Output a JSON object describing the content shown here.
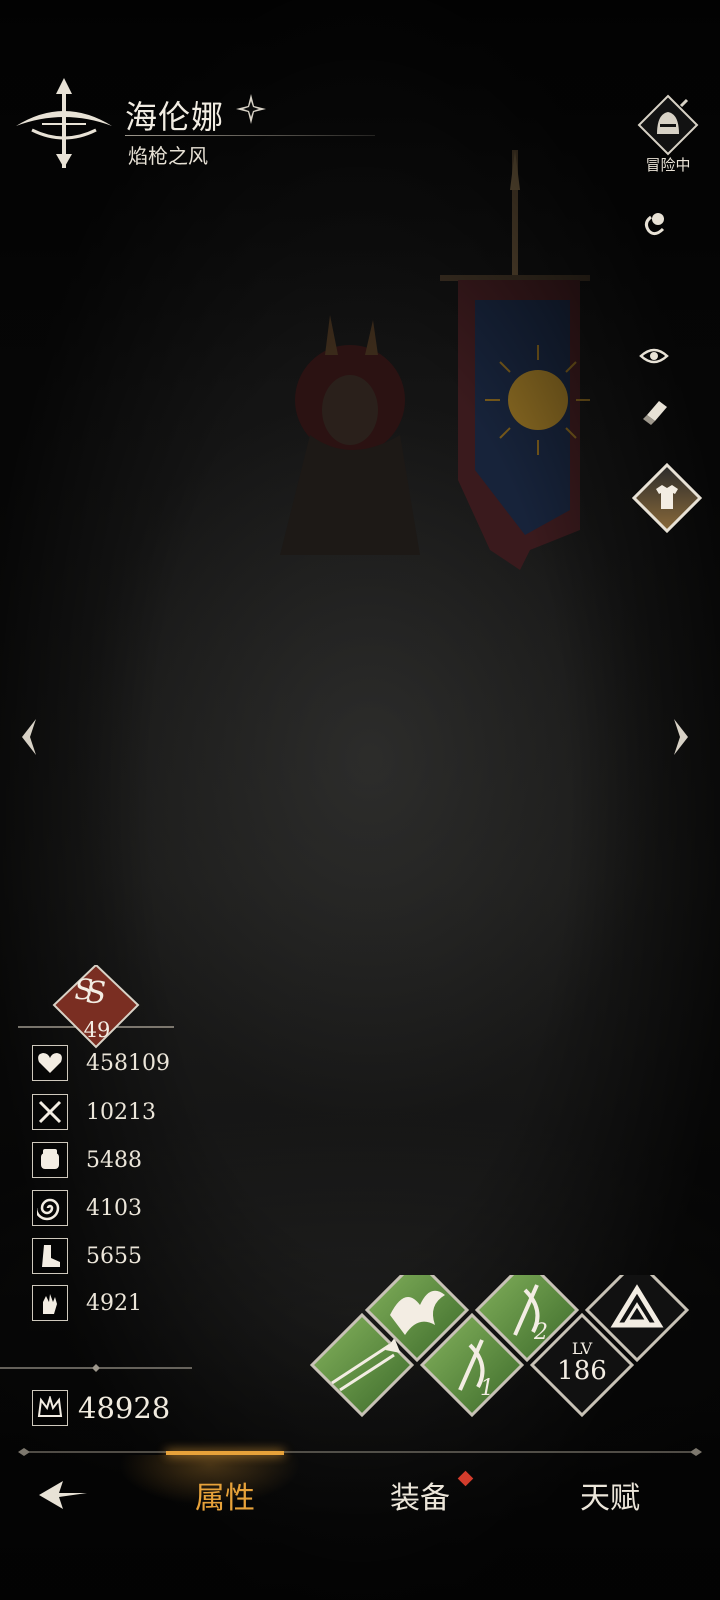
{
  "hero": {
    "name": "海伦娜",
    "title": "焰枪之风"
  },
  "side_menu": {
    "adventure_status": "冒险中"
  },
  "rank": {
    "grade": "S",
    "level": "49"
  },
  "stats": [
    {
      "icon": "heart-icon",
      "value": "458109"
    },
    {
      "icon": "crossed-swords-icon",
      "value": "10213"
    },
    {
      "icon": "fist-icon",
      "value": "5488"
    },
    {
      "icon": "swirl-icon",
      "value": "4103"
    },
    {
      "icon": "boot-icon",
      "value": "5655"
    },
    {
      "icon": "hand-icon",
      "value": "4921"
    }
  ],
  "combat_power": "48928",
  "skills": {
    "level_label": "LV",
    "level_value": "186",
    "slot_1": "1",
    "slot_2": "2"
  },
  "tabs": [
    {
      "label": "属性",
      "active": true
    },
    {
      "label": "装备",
      "active": false,
      "badge": true
    },
    {
      "label": "天赋",
      "active": false
    }
  ],
  "colors": {
    "accent": "#e7a23a",
    "rank_badge": "#7a2e22",
    "skill_green": "#5d8f3f",
    "notification": "#d23c2c"
  }
}
